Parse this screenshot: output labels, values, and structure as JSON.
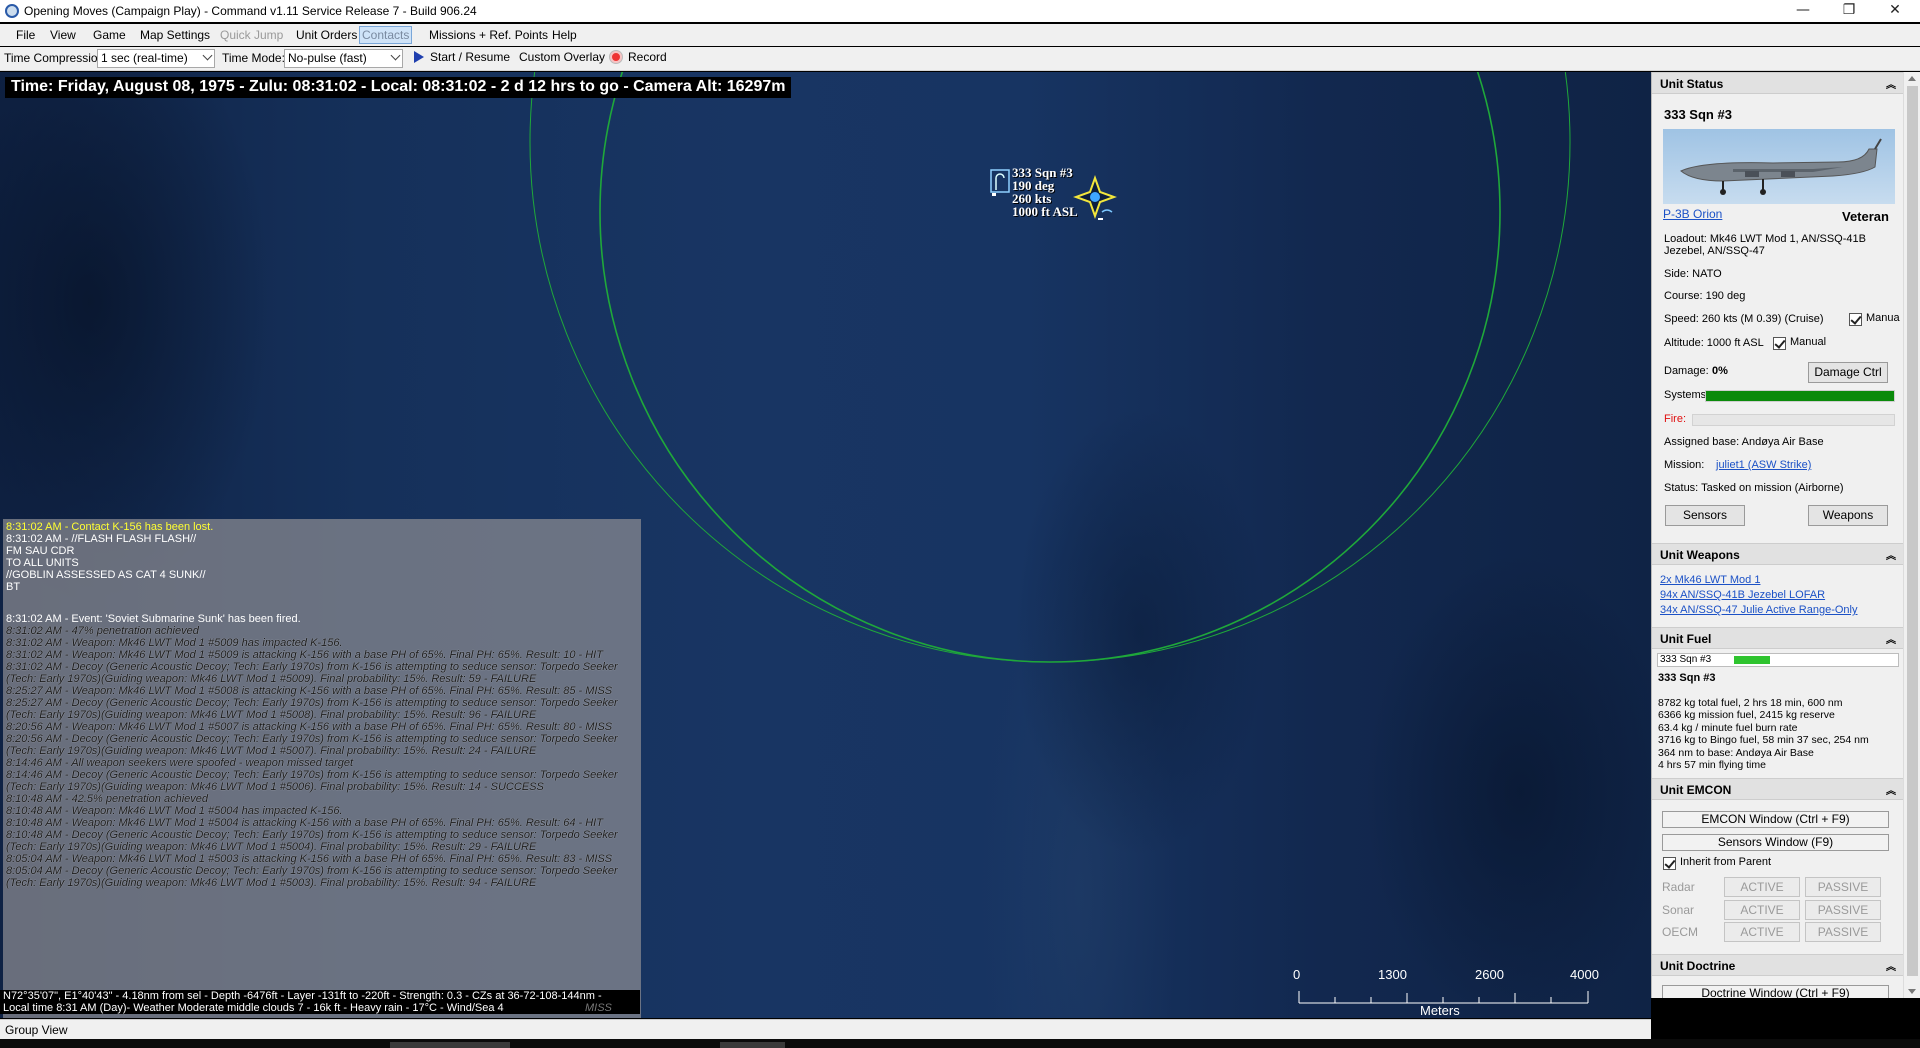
{
  "window": {
    "title": "Opening Moves (Campaign Play) - Command v1.11 Service Release 7 - Build 906.24",
    "controls": [
      "—",
      "❐",
      "✕"
    ]
  },
  "menu": [
    {
      "label": "File",
      "state": "normal"
    },
    {
      "label": "View",
      "state": "normal"
    },
    {
      "label": "Game",
      "state": "normal"
    },
    {
      "label": "Map Settings",
      "state": "normal"
    },
    {
      "label": "Quick Jump",
      "state": "disabled"
    },
    {
      "label": "Unit Orders",
      "state": "normal"
    },
    {
      "label": "Contacts",
      "state": "selected"
    },
    {
      "label": "Missions + Ref. Points",
      "state": "normal"
    },
    {
      "label": "Help",
      "state": "normal"
    }
  ],
  "toolbar": {
    "time_compression_label": "Time Compression:",
    "time_compression_value": "1 sec (real-time)",
    "time_mode_label": "Time Mode:",
    "time_mode_value": "No-pulse (fast)",
    "start_label": "Start / Resume",
    "custom_overlay_label": "Custom Overlay",
    "record_label": "Record"
  },
  "map": {
    "status_bar": "Time: Friday, August 08, 1975 - Zulu: 08:31:02 - Local: 08:31:02 - 2 d 12 hrs to go -  Camera Alt: 16297m",
    "unit_label": [
      "333 Sqn #3",
      "190 deg",
      "260 kts",
      "1000 ft ASL"
    ],
    "colors": {
      "range_ring": "#1fa83a",
      "unit_symbol": "#f2e63c",
      "ocean": "#17325f"
    }
  },
  "log": {
    "messages": [
      {
        "style": "y",
        "text": "8:31:02 AM - Contact K-156 has been lost."
      },
      {
        "style": "w",
        "text": "8:31:02 AM - //FLASH FLASH FLASH//"
      },
      {
        "style": "w",
        "text": "FM SAU CDR"
      },
      {
        "style": "w",
        "text": "TO ALL UNITS"
      },
      {
        "style": "w",
        "text": "//GOBLIN ASSESSED AS CAT 4 SUNK//"
      },
      {
        "style": "w",
        "text": "BT"
      },
      {
        "style": "gap",
        "text": ""
      },
      {
        "style": "gap",
        "text": ""
      },
      {
        "style": "w",
        "text": "8:31:02 AM - Event: 'Soviet Submarine Sunk' has been fired."
      },
      {
        "style": "i",
        "text": "8:31:02 AM - 47% penetration achieved"
      },
      {
        "style": "i",
        "text": "8:31:02 AM - Weapon: Mk46 LWT Mod 1 #5009 has impacted K-156."
      },
      {
        "style": "i",
        "text": "8:31:02 AM - Weapon: Mk46 LWT Mod 1 #5009 is attacking K-156 with a base PH of 65%. Final PH: 65%. Result: 10 - HIT"
      },
      {
        "style": "i",
        "text": "8:31:02 AM - Decoy (Generic Acoustic Decoy; Tech: Early 1970s) from K-156 is attempting to seduce sensor: Torpedo Seeker"
      },
      {
        "style": "i",
        "text": "(Tech: Early 1970s)(Guiding weapon: Mk46 LWT Mod 1 #5009). Final probability: 15%. Result: 59 - FAILURE"
      },
      {
        "style": "i",
        "text": "8:25:27 AM - Weapon: Mk46 LWT Mod 1 #5008 is attacking K-156 with a base PH of 65%. Final PH: 65%. Result: 85 - MISS"
      },
      {
        "style": "i",
        "text": "8:25:27 AM - Decoy (Generic Acoustic Decoy; Tech: Early 1970s) from K-156 is attempting to seduce sensor: Torpedo Seeker"
      },
      {
        "style": "i",
        "text": "(Tech: Early 1970s)(Guiding weapon: Mk46 LWT Mod 1 #5008). Final probability: 15%. Result: 96 - FAILURE"
      },
      {
        "style": "i",
        "text": "8:20:56 AM - Weapon: Mk46 LWT Mod 1 #5007 is attacking K-156 with a base PH of 65%. Final PH: 65%. Result: 80 - MISS"
      },
      {
        "style": "i",
        "text": "8:20:56 AM - Decoy (Generic Acoustic Decoy; Tech: Early 1970s) from K-156 is attempting to seduce sensor: Torpedo Seeker"
      },
      {
        "style": "i",
        "text": "(Tech: Early 1970s)(Guiding weapon: Mk46 LWT Mod 1 #5007). Final probability: 15%. Result: 24 - FAILURE"
      },
      {
        "style": "i",
        "text": "8:14:46 AM - All weapon seekers were spoofed - weapon missed target"
      },
      {
        "style": "i",
        "text": "8:14:46 AM - Decoy (Generic Acoustic Decoy; Tech: Early 1970s) from K-156 is attempting to seduce sensor: Torpedo Seeker"
      },
      {
        "style": "i",
        "text": "(Tech: Early 1970s)(Guiding weapon: Mk46 LWT Mod 1 #5006). Final probability: 15%. Result: 14 - SUCCESS"
      },
      {
        "style": "i",
        "text": "8:10:48 AM - 42.5% penetration achieved"
      },
      {
        "style": "i",
        "text": "8:10:48 AM - Weapon: Mk46 LWT Mod 1 #5004 has impacted K-156."
      },
      {
        "style": "i",
        "text": "8:10:48 AM - Weapon: Mk46 LWT Mod 1 #5004 is attacking K-156 with a base PH of 65%. Final PH: 65%. Result: 64 - HIT"
      },
      {
        "style": "i",
        "text": "8:10:48 AM - Decoy (Generic Acoustic Decoy; Tech: Early 1970s) from K-156 is attempting to seduce sensor: Torpedo Seeker"
      },
      {
        "style": "i",
        "text": "(Tech: Early 1970s)(Guiding weapon: Mk46 LWT Mod 1 #5004). Final probability: 15%. Result: 29 - FAILURE"
      },
      {
        "style": "i",
        "text": "8:05:04 AM - Weapon: Mk46 LWT Mod 1 #5003 is attacking K-156 with a base PH of 65%. Final PH: 65%. Result: 83 - MISS"
      },
      {
        "style": "i",
        "text": "8:05:04 AM - Decoy (Generic Acoustic Decoy; Tech: Early 1970s) from K-156 is attempting to seduce sensor: Torpedo Seeker"
      },
      {
        "style": "i",
        "text": "(Tech: Early 1970s)(Guiding weapon: Mk46 LWT Mod 1 #5003). Final probability: 15%. Result: 94 - FAILURE"
      }
    ],
    "info_line1": "N72°35'07\", E1°40'43\" - 4.18nm from sel - Depth -6476ft - Layer -131ft to -220ft - Strength: 0.3 - CZs at 36-72-108-144nm -",
    "info_line2": "Local time 8:31 AM (Day)- Weather Moderate middle clouds 7 - 16k ft - Heavy rain - 17°C - Wind/Sea 4",
    "trailing_fragment": "MISS"
  },
  "scale": {
    "ticks": [
      "0",
      "1300",
      "2600",
      "4000"
    ],
    "unit": "Meters"
  },
  "group_view_label": "Group View",
  "unit_status": {
    "header": "Unit Status",
    "unit_name": "333 Sqn #3",
    "aircraft_type": "P-3B Orion",
    "proficiency": "Veteran",
    "loadout_line1": "Loadout: Mk46 LWT Mod 1, AN/SSQ-41B",
    "loadout_line2": "Jezebel, AN/SSQ-47",
    "side": "Side: NATO",
    "course": "Course: 190 deg",
    "speed": "Speed: 260 kts (M 0.39) (Cruise)",
    "speed_manual": "Manua",
    "altitude": "Altitude: 1000 ft ASL",
    "altitude_manual": "Manual",
    "damage_label": "Damage:",
    "damage_value": "0%",
    "damage_ctrl_button": "Damage Ctrl",
    "systems_label": "Systems:",
    "systems_level": 1.0,
    "fire_label": "Fire:",
    "fire_level": 0.0,
    "assigned_base": "Assigned base: Andøya Air Base",
    "mission_label": "Mission:",
    "mission_value": "juliet1 (ASW Strike)",
    "status": "Status: Tasked on mission (Airborne)",
    "sensors_button": "Sensors",
    "weapons_button": "Weapons"
  },
  "unit_weapons": {
    "header": "Unit Weapons",
    "items": [
      "2x Mk46 LWT Mod 1",
      "94x AN/SSQ-41B Jezebel LOFAR",
      "34x AN/SSQ-47 Julie Active Range-Only"
    ]
  },
  "unit_fuel": {
    "header": "Unit Fuel",
    "bar_label": "333 Sqn #3",
    "bar_level": 0.22,
    "unit_name": "333 Sqn #3",
    "lines": [
      "8782 kg total fuel, 2 hrs 18 min, 600 nm",
      "6366 kg mission fuel, 2415 kg reserve",
      "63.4 kg / minute fuel burn rate",
      "3716 kg to Bingo fuel, 58 min 37 sec, 254 nm",
      "364 nm to base: Andøya Air Base",
      "4 hrs 57 min flying time"
    ]
  },
  "unit_emcon": {
    "header": "Unit EMCON",
    "emcon_window_button": "EMCON Window (Ctrl + F9)",
    "sensors_window_button": "Sensors Window (F9)",
    "inherit_label": "Inherit from Parent",
    "rows": [
      {
        "name": "Radar",
        "active": "ACTIVE",
        "passive": "PASSIVE"
      },
      {
        "name": "Sonar",
        "active": "ACTIVE",
        "passive": "PASSIVE"
      },
      {
        "name": "OECM",
        "active": "ACTIVE",
        "passive": "PASSIVE"
      }
    ]
  },
  "unit_doctrine": {
    "header": "Unit Doctrine",
    "button": "Doctrine Window (Ctrl + F9)"
  },
  "colors": {
    "systems_bar": "#0a8a0a",
    "fuel_bar": "#2fc42f",
    "fire_label": "#e01010",
    "link": "#1b51c6"
  }
}
